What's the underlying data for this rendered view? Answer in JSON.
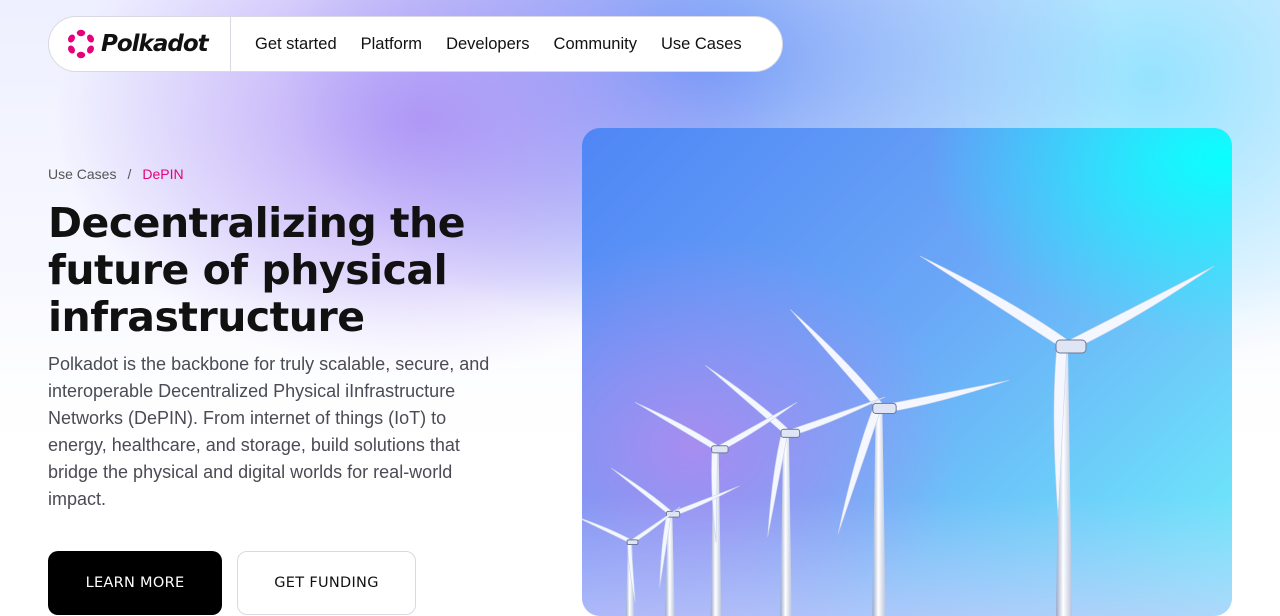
{
  "nav": {
    "brand": "Polkadot",
    "brand_color": "#e6007a",
    "items": [
      "Get started",
      "Platform",
      "Developers",
      "Community",
      "Use Cases"
    ]
  },
  "breadcrumb": {
    "parent": "Use Cases",
    "separator": "/",
    "current": "DePIN"
  },
  "hero": {
    "title": "Decentralizing the future of physical infrastructure",
    "description": "Polkadot is the backbone for truly scalable, secure, and interoperable Decentralized Physical iInfrastructure Networks (DePIN). From internet of things (IoT) to energy, healthcare, and storage, build solutions that bridge the physical and digital worlds for real-world impact.",
    "primary_button": "LEARN MORE",
    "secondary_button": "GET FUNDING",
    "image_icon": "wind-turbines-image"
  }
}
